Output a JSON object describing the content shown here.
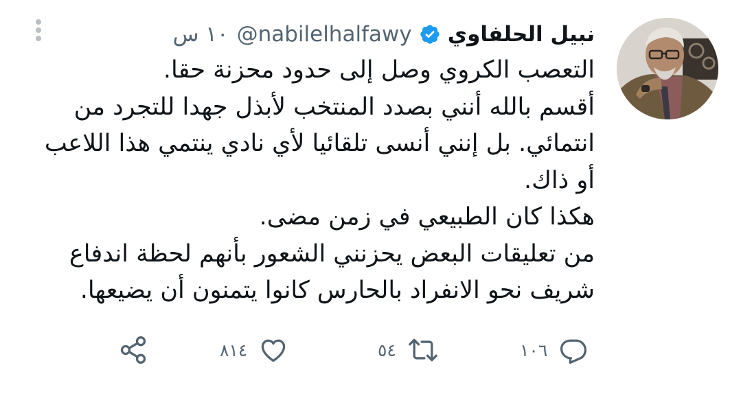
{
  "author": {
    "display_name": "نبيل الحلفاوي",
    "handle": "@nabilelhalfawy",
    "verified": true,
    "time": "١٠ س"
  },
  "tweet": {
    "lines": [
      "التعصب الكروي وصل إلى حدود محزنة حقا.",
      "أقسم بالله أنني بصدد المنتخب لأبذل جهدا للتجرد من",
      "انتمائي. بل إنني أنسى تلقائيا لأي نادي ينتمي هذا اللاعب",
      "أو ذاك.",
      "هكذا كان الطبيعي في زمن مضى.",
      "من تعليقات البعض يحزنني الشعور بأنهم لحظة اندفاع",
      "شريف نحو الانفراد بالحارس كانوا يتمنون أن يضيعها."
    ]
  },
  "actions": {
    "replies": "١٠٦",
    "retweets": "٥٤",
    "likes": "٨١٤"
  },
  "icons": {
    "more": "more-vertical-icon",
    "verified": "verified-badge-icon",
    "reply": "reply-icon",
    "retweet": "retweet-icon",
    "like": "heart-icon",
    "share": "share-icon"
  },
  "colors": {
    "text": "#0f1419",
    "secondary": "#536471",
    "verified": "#1d9bf0",
    "menu_dots": "#b9bfc5"
  }
}
